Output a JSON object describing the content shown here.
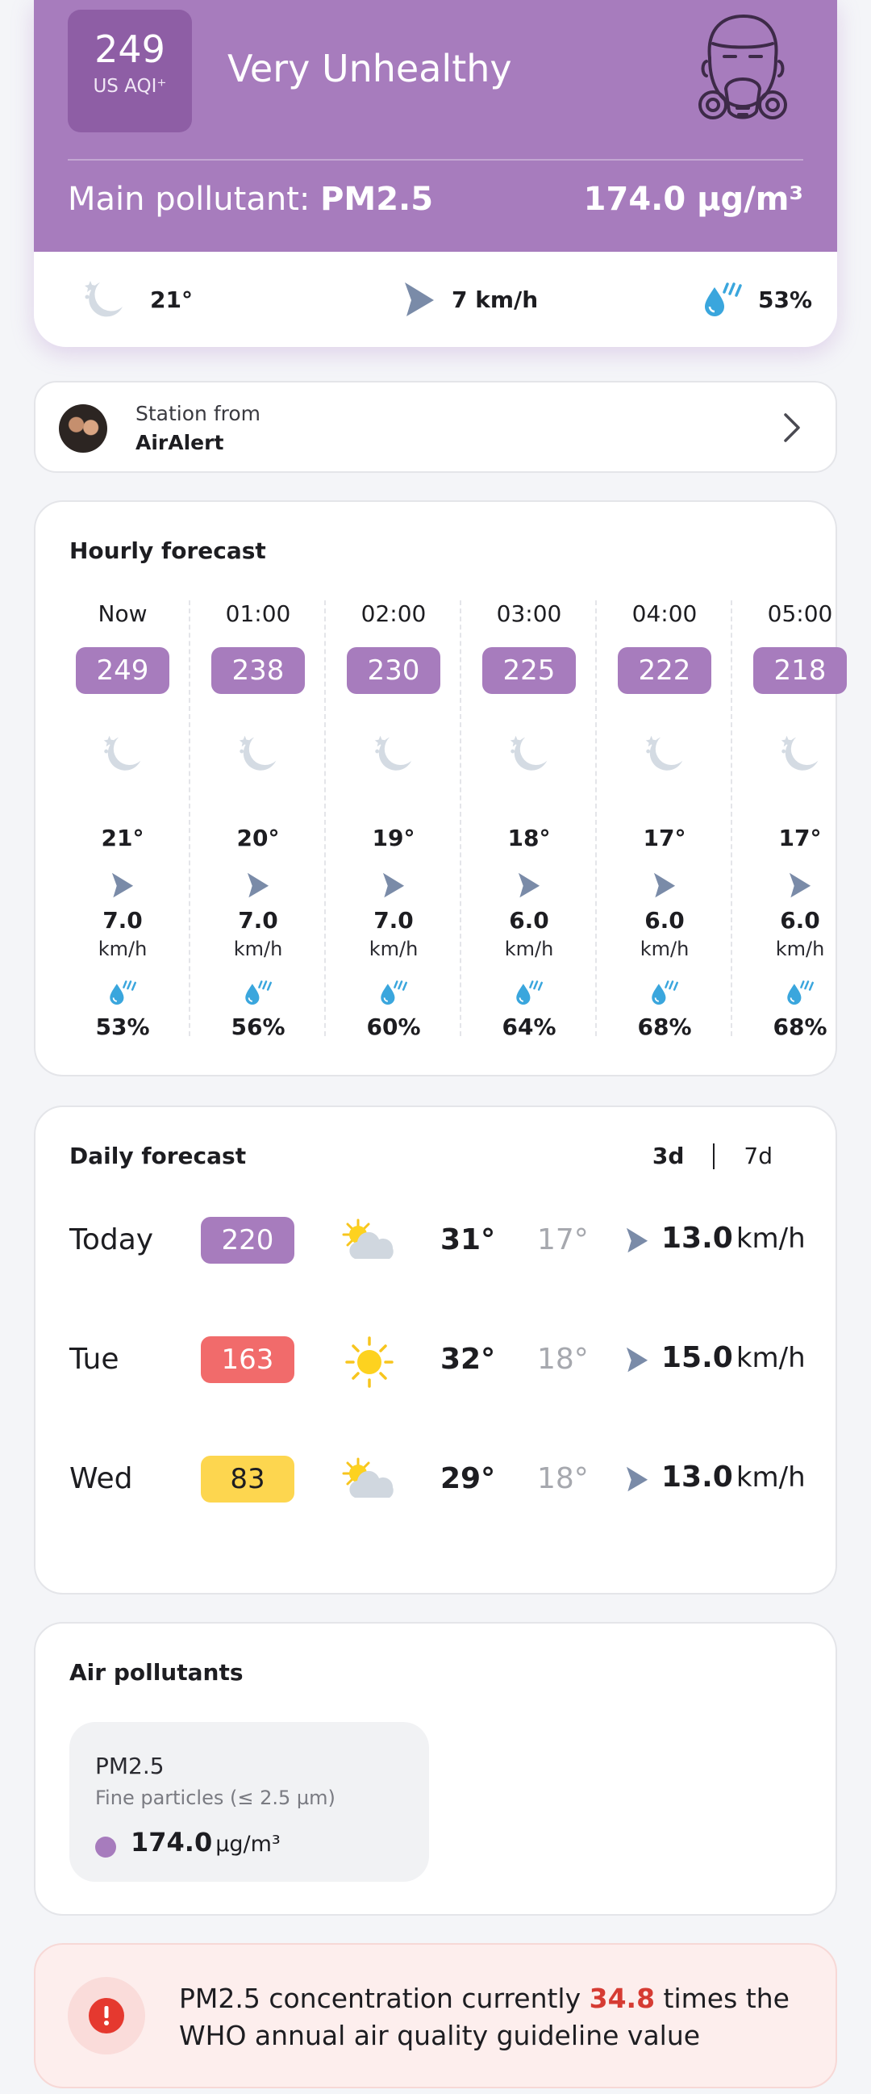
{
  "aqi": {
    "value": "249",
    "unit": "US AQI⁺",
    "level": "Very Unhealthy",
    "main_pollutant_label": "Main pollutant:",
    "main_pollutant": "PM2.5",
    "concentration": "174.0 µg/m³",
    "color": "#a77cbd"
  },
  "weather": {
    "temp": "21°",
    "wind": "7 km/h",
    "humidity": "53%"
  },
  "station": {
    "from_label": "Station from",
    "name": "AirAlert"
  },
  "hourly": {
    "title": "Hourly forecast",
    "items": [
      {
        "time": "Now",
        "aqi": "249",
        "temp": "21°",
        "wind": "7.0",
        "wind_unit": "km/h",
        "humidity": "53%"
      },
      {
        "time": "01:00",
        "aqi": "238",
        "temp": "20°",
        "wind": "7.0",
        "wind_unit": "km/h",
        "humidity": "56%"
      },
      {
        "time": "02:00",
        "aqi": "230",
        "temp": "19°",
        "wind": "7.0",
        "wind_unit": "km/h",
        "humidity": "60%"
      },
      {
        "time": "03:00",
        "aqi": "225",
        "temp": "18°",
        "wind": "6.0",
        "wind_unit": "km/h",
        "humidity": "64%"
      },
      {
        "time": "04:00",
        "aqi": "222",
        "temp": "17°",
        "wind": "6.0",
        "wind_unit": "km/h",
        "humidity": "68%"
      },
      {
        "time": "05:00",
        "aqi": "218",
        "temp": "17°",
        "wind": "6.0",
        "wind_unit": "km/h",
        "humidity": "68%"
      }
    ]
  },
  "daily": {
    "title": "Daily forecast",
    "tabs": [
      "3d",
      "7d"
    ],
    "selected_tab": "3d",
    "items": [
      {
        "day": "Today",
        "aqi": "220",
        "aqi_color": "#a77cbd",
        "aqi_text_color": "#ffffff",
        "icon": "partly-cloudy-icon",
        "high": "31°",
        "low": "17°",
        "wind": "13.0",
        "wind_unit": "km/h"
      },
      {
        "day": "Tue",
        "aqi": "163",
        "aqi_color": "#f16b6b",
        "aqi_text_color": "#ffffff",
        "icon": "sun-icon",
        "high": "32°",
        "low": "18°",
        "wind": "15.0",
        "wind_unit": "km/h"
      },
      {
        "day": "Wed",
        "aqi": "83",
        "aqi_color": "#fdd64f",
        "aqi_text_color": "#1d1d21",
        "icon": "partly-cloudy-icon",
        "high": "29°",
        "low": "18°",
        "wind": "13.0",
        "wind_unit": "km/h"
      }
    ]
  },
  "pollutants": {
    "title": "Air pollutants",
    "items": [
      {
        "name": "PM2.5",
        "description": "Fine particles (≤ 2.5 µm)",
        "value": "174.0",
        "unit": "µg/m³",
        "color": "#a77cbd"
      }
    ]
  },
  "alert": {
    "text_before": "PM2.5 concentration currently ",
    "highlight": "34.8",
    "text_after": " times the WHO annual air quality guideline value",
    "color": "#d63b33"
  }
}
